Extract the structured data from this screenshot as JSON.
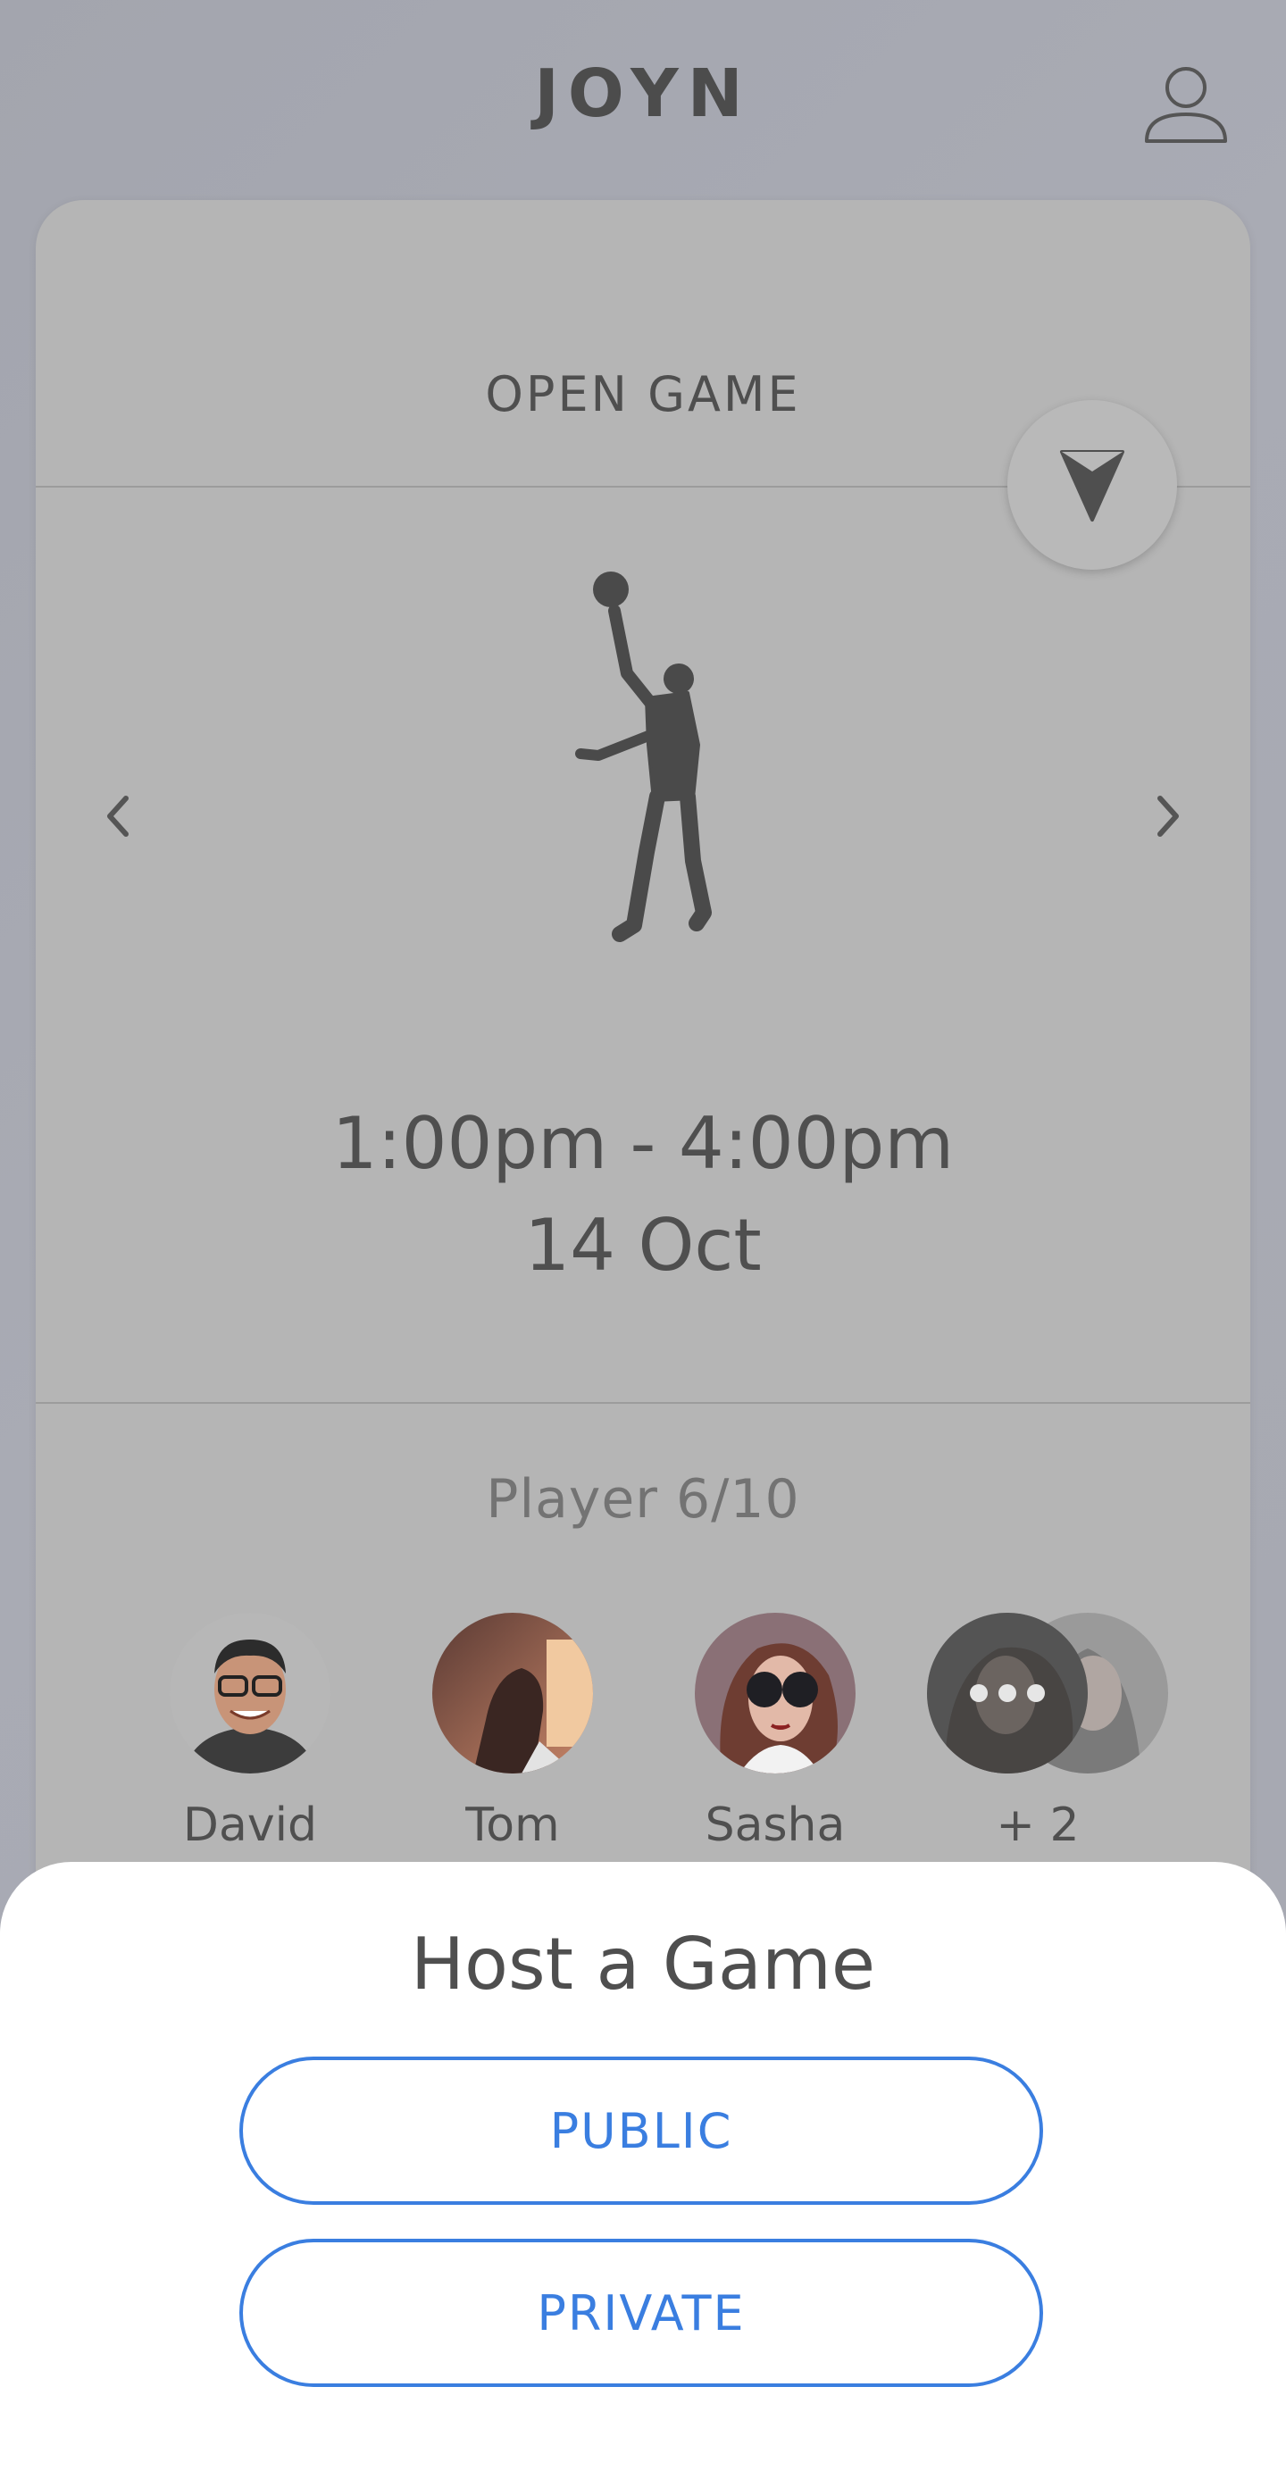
{
  "app": {
    "title": "JOYN"
  },
  "card": {
    "title": "OPEN GAME",
    "time_range": "1:00pm - 4:00pm",
    "date": "14 Oct",
    "players": {
      "label": "Player",
      "count": "6/10"
    },
    "avatars": [
      {
        "name": "David"
      },
      {
        "name": "Tom"
      },
      {
        "name": "Sasha"
      },
      {
        "name": "+ 2"
      }
    ]
  },
  "sheet": {
    "title": "Host a Game",
    "public_label": "PUBLIC",
    "private_label": "PRIVATE"
  },
  "colors": {
    "accent": "#3a7ee0",
    "background": "#a6a8b1",
    "card": "#b5b5b5",
    "text": "#4f4f4f"
  },
  "icons": {
    "profile": "user-icon",
    "locate": "navigation-arrow-icon",
    "prev": "chevron-left-icon",
    "next": "chevron-right-icon",
    "sport": "basketball-player-icon",
    "more": "more-dots-icon"
  }
}
